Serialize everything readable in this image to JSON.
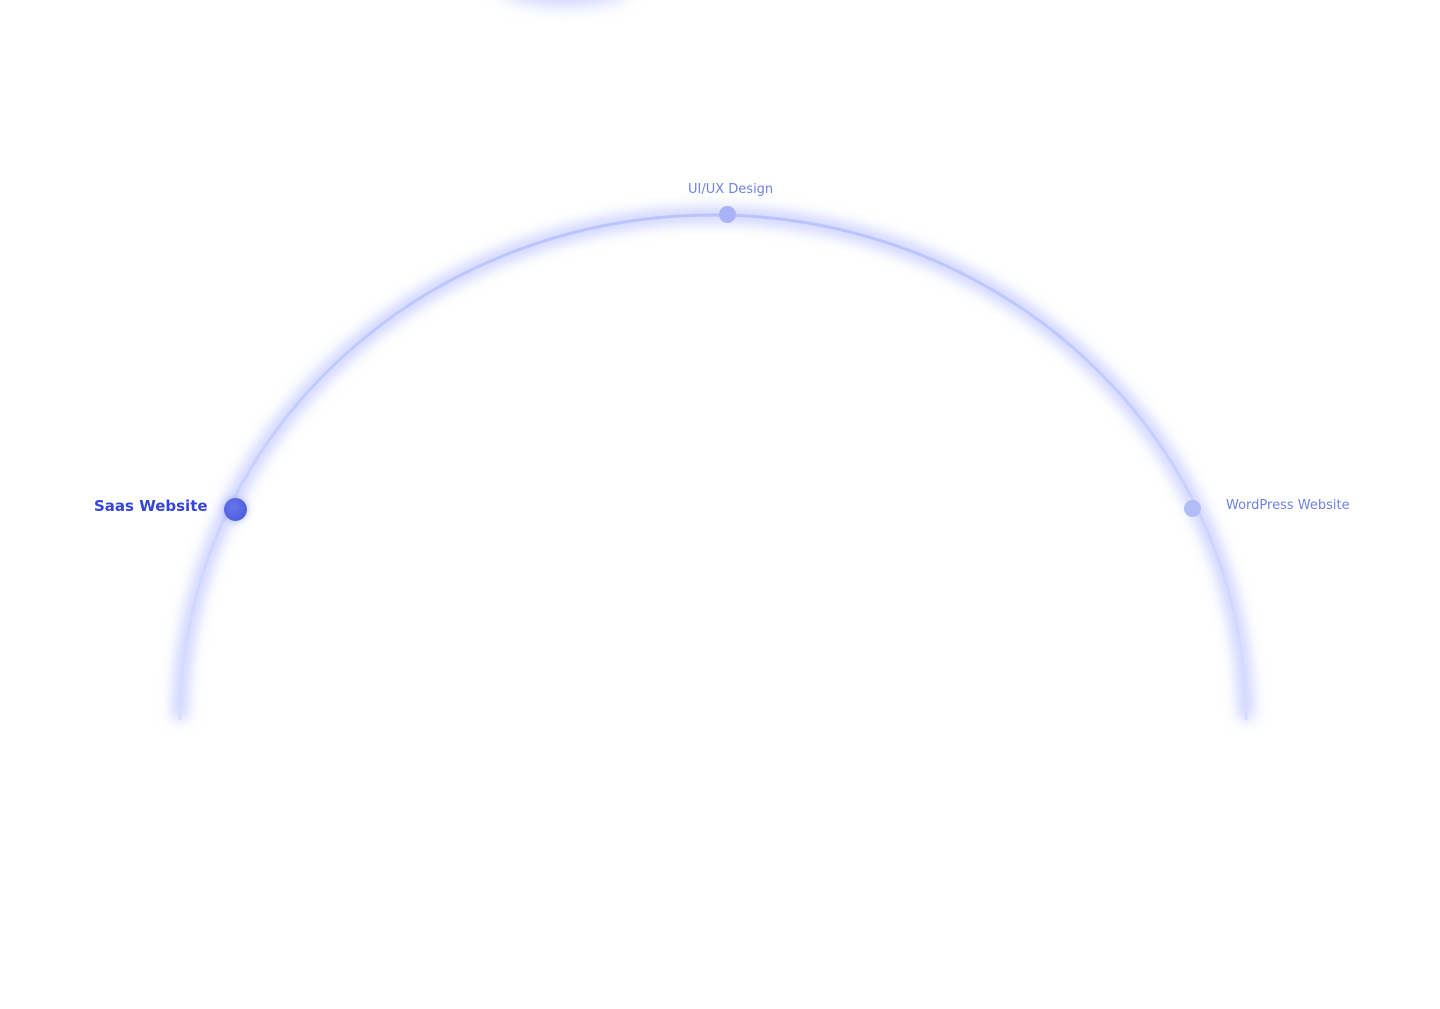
{
  "services": {
    "items": [
      {
        "label": "UI/UX Design",
        "state": "inactive"
      },
      {
        "label": "Saas Website",
        "state": "active"
      },
      {
        "label": "WordPress Website",
        "state": "inactive"
      }
    ]
  },
  "colors": {
    "accent": "#3446d6",
    "muted_label": "#6f82e4",
    "arc": "#c6ceff",
    "glow": "#9aa6ff"
  }
}
